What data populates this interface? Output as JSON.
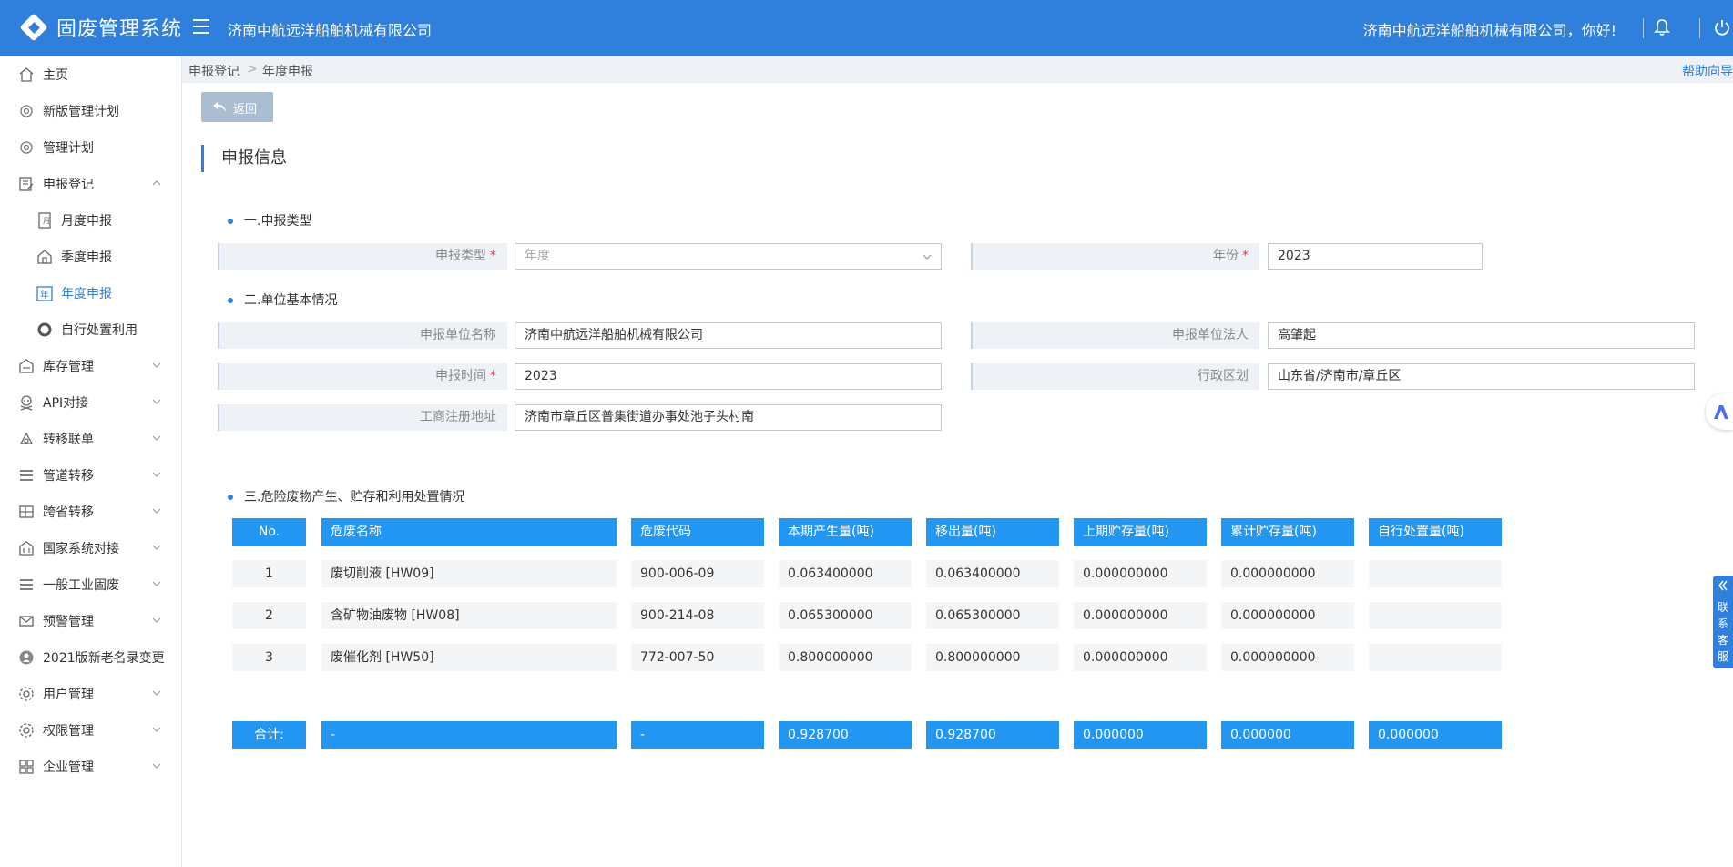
{
  "header": {
    "app_title": "固废管理系统",
    "company": "济南中航远洋船舶机械有限公司",
    "greeting": "济南中航远洋船舶机械有限公司，你好!"
  },
  "sidebar": {
    "items": [
      {
        "label": "主页",
        "icon": "home-icon"
      },
      {
        "label": "新版管理计划",
        "icon": "planet-icon"
      },
      {
        "label": "管理计划",
        "icon": "planet-icon"
      },
      {
        "label": "申报登记",
        "icon": "edit-doc-icon",
        "expanded": true
      },
      {
        "label": "月度申报",
        "icon": "doc-icon",
        "sub": true
      },
      {
        "label": "季度申报",
        "icon": "building-icon",
        "sub": true
      },
      {
        "label": "年度申报",
        "icon": "year-icon",
        "sub": true,
        "active": true
      },
      {
        "label": "自行处置利用",
        "icon": "circle-icon",
        "sub": true
      },
      {
        "label": "库存管理",
        "icon": "warehouse-icon"
      },
      {
        "label": "API对接",
        "icon": "skull-icon"
      },
      {
        "label": "转移联单",
        "icon": "transfer-icon"
      },
      {
        "label": "管道转移",
        "icon": "list-icon"
      },
      {
        "label": "跨省转移",
        "icon": "cross-province-icon"
      },
      {
        "label": "国家系统对接",
        "icon": "bank-icon"
      },
      {
        "label": "一般工业固废",
        "icon": "list-icon"
      },
      {
        "label": "预警管理",
        "icon": "mail-icon"
      },
      {
        "label": "2021版新老名录变更",
        "icon": "user-badge-icon"
      },
      {
        "label": "用户管理",
        "icon": "gear-icon"
      },
      {
        "label": "权限管理",
        "icon": "gear-icon"
      },
      {
        "label": "企业管理",
        "icon": "grid-icon"
      }
    ]
  },
  "breadcrumb": {
    "level1": "申报登记",
    "separator": ">",
    "level2": "年度申报",
    "help": "帮助向导"
  },
  "back_button": "返回",
  "section_title": "申报信息",
  "form": {
    "sec1": "一.申报类型",
    "report_type_label": "申报类型",
    "report_type_value": "年度",
    "year_label": "年份",
    "year_value": "2023",
    "sec2": "二.单位基本情况",
    "unit_name_label": "申报单位名称",
    "unit_name_value": "济南中航远洋船舶机械有限公司",
    "legal_person_label": "申报单位法人",
    "legal_person_value": "高肇起",
    "report_time_label": "申报时间",
    "report_time_value": "2023",
    "region_label": "行政区划",
    "region_value": "山东省/济南市/章丘区",
    "address_label": "工商注册地址",
    "address_value": "济南市章丘区普集街道办事处池子头村南",
    "required_mark": "*"
  },
  "table": {
    "title": "三.危险废物产生、贮存和利用处置情况",
    "headers": [
      "No.",
      "危废名称",
      "危废代码",
      "本期产生量(吨)",
      "移出量(吨)",
      "上期贮存量(吨)",
      "累计贮存量(吨)",
      "自行处置量(吨)"
    ],
    "rows": [
      [
        "1",
        "废切削液 [HW09]",
        "900-006-09",
        "0.063400000",
        "0.063400000",
        "0.000000000",
        "0.000000000",
        ""
      ],
      [
        "2",
        "含矿物油废物 [HW08]",
        "900-214-08",
        "0.065300000",
        "0.065300000",
        "0.000000000",
        "0.000000000",
        ""
      ],
      [
        "3",
        "废催化剂 [HW50]",
        "772-007-50",
        "0.800000000",
        "0.800000000",
        "0.000000000",
        "0.000000000",
        ""
      ]
    ],
    "footer": [
      "合计:",
      "-",
      "-",
      "0.928700",
      "0.928700",
      "0.000000",
      "0.000000",
      "0.000000"
    ]
  },
  "customer_service": "联系客服",
  "colors": {
    "brand": "#2f7fdd",
    "table_header": "#2196f3",
    "required": "#e53935"
  }
}
